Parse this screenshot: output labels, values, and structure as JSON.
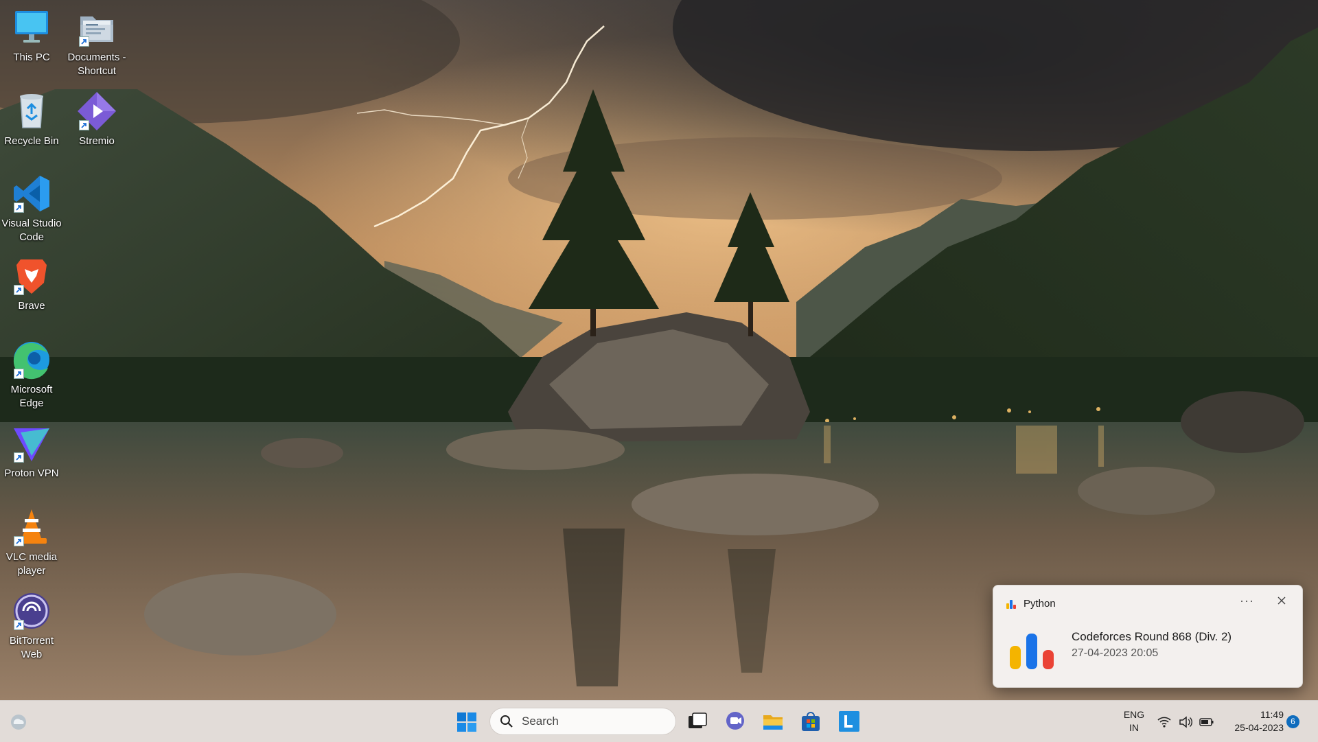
{
  "desktop": {
    "icons": [
      {
        "label": "This PC",
        "icon": "monitor-icon"
      },
      {
        "label": "Documents - Shortcut",
        "icon": "folder-icon"
      },
      {
        "label": "Recycle Bin",
        "icon": "recycle-bin-icon"
      },
      {
        "label": "Stremio",
        "icon": "stremio-icon"
      },
      {
        "label": "Visual Studio Code",
        "icon": "vscode-icon"
      },
      {
        "label": "Brave",
        "icon": "brave-icon"
      },
      {
        "label": "Microsoft Edge",
        "icon": "edge-icon"
      },
      {
        "label": "Proton VPN",
        "icon": "protonvpn-icon"
      },
      {
        "label": "VLC media player",
        "icon": "vlc-icon"
      },
      {
        "label": "BitTorrent Web",
        "icon": "bittorrent-icon"
      }
    ]
  },
  "notification": {
    "app_name": "Python",
    "more_label": "···",
    "title": "Codeforces Round 868 (Div. 2)",
    "subtitle": "27-04-2023 20:05"
  },
  "taskbar": {
    "search_placeholder": "Search",
    "apps": [
      "task-view-icon",
      "teams-chat-icon",
      "file-explorer-icon",
      "microsoft-store-icon",
      "launcher-icon"
    ],
    "language": {
      "line1": "ENG",
      "line2": "IN"
    },
    "time": "11:49",
    "date": "25-04-2023",
    "notification_count": "6"
  },
  "colors": {
    "accent": "#0f6cbd",
    "taskbar_bg": "#e8e2de",
    "toast_bg": "#f3f0ee"
  }
}
